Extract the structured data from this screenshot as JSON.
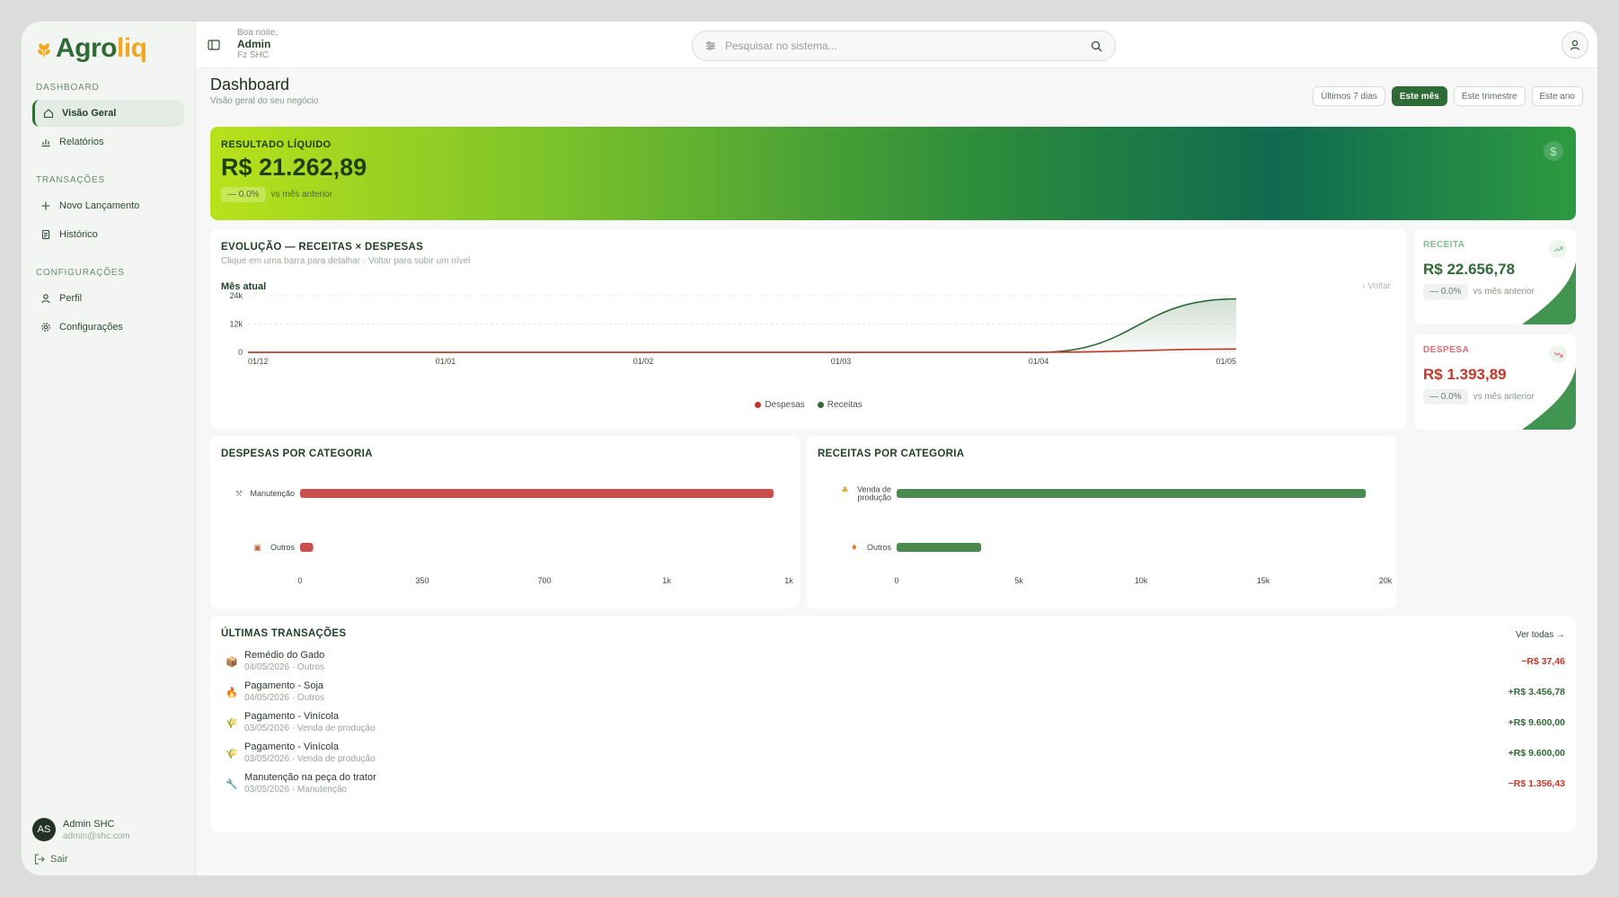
{
  "app": {
    "logo_a": "Agro",
    "logo_b": "liq"
  },
  "sidebar": {
    "sections": [
      {
        "title": "DASHBOARD",
        "items": [
          {
            "label": "Visão Geral",
            "icon": "home-icon",
            "active": true
          },
          {
            "label": "Relatórios",
            "icon": "bar-chart-icon"
          }
        ]
      },
      {
        "title": "TRANSAÇÕES",
        "items": [
          {
            "label": "Novo Lançamento",
            "icon": "plus-icon"
          },
          {
            "label": "Histórico",
            "icon": "document-icon"
          }
        ]
      },
      {
        "title": "CONFIGURAÇÕES",
        "items": [
          {
            "label": "Perfil",
            "icon": "user-icon"
          },
          {
            "label": "Configurações",
            "icon": "gear-icon"
          }
        ]
      }
    ],
    "user": {
      "initials": "AS",
      "name": "Admin SHC",
      "email": "admin@shc.com"
    },
    "logout_label": "Sair"
  },
  "header": {
    "greeting": "Boa noite,",
    "user": "Admin",
    "farm": "Fz SHC",
    "search_placeholder": "Pesquisar no sistema..."
  },
  "page": {
    "title": "Dashboard",
    "subtitle": "Visão geral do seu negócio",
    "periods": [
      "Últimos 7 dias",
      "Este mês",
      "Este trimestre",
      "Este ano"
    ],
    "active_period": "Este mês"
  },
  "hero": {
    "label": "RESULTADO LÍQUIDO",
    "value": "R$ 21.262,89",
    "delta": "— 0.0%",
    "delta_text": "vs mês anterior",
    "icon": "dollar-icon"
  },
  "kpis": [
    {
      "label": "RECEITA",
      "value": "R$ 22.656,78",
      "delta": "— 0.0%",
      "delta_text": "vs mês anterior",
      "color": "#2e6b35",
      "label_color": "#7dbf8a",
      "icon": "trend-up-icon"
    },
    {
      "label": "DESPESA",
      "value": "R$ 1.393,89",
      "delta": "— 0.0%",
      "delta_text": "vs mês anterior",
      "color": "#c0392b",
      "label_color": "#e06a76",
      "icon": "trend-down-icon"
    }
  ],
  "evolution": {
    "title": "EVOLUÇÃO — RECEITAS × DESPESAS",
    "subtitle": "Clique em uma barra para detalhar · Voltar para subir um nível",
    "period_label": "Mês atual",
    "back_label": "‹ Voltar"
  },
  "categories_expense": {
    "title": "DESPESAS POR CATEGORIA"
  },
  "categories_income": {
    "title": "RECEITAS POR CATEGORIA"
  },
  "chart_data": [
    {
      "type": "area",
      "title": "EVOLUÇÃO — RECEITAS × DESPESAS",
      "x": [
        "01/12",
        "01/01",
        "01/02",
        "01/03",
        "01/04",
        "01/05"
      ],
      "ylim": [
        0,
        24000
      ],
      "yticks": [
        "24k",
        "12k",
        "0"
      ],
      "series": [
        {
          "name": "Despesas",
          "color": "#c0392b",
          "values": [
            0,
            0,
            0,
            0,
            0,
            1393.89
          ]
        },
        {
          "name": "Receitas",
          "color": "#2e6b35",
          "values": [
            0,
            0,
            0,
            0,
            0,
            22656.78
          ]
        }
      ],
      "legend": "bottom-center"
    },
    {
      "type": "bar",
      "orientation": "horizontal",
      "title": "DESPESAS POR CATEGORIA",
      "categories": [
        {
          "label": "Manutenção",
          "icon": "wrench-icon"
        },
        {
          "label": "Outros",
          "icon": "box-icon"
        }
      ],
      "values": [
        1356.43,
        37.46
      ],
      "xlim": [
        0,
        1400
      ],
      "xticks": [
        "0",
        "350",
        "700",
        "1k",
        "1k"
      ],
      "color": "#c9504d"
    },
    {
      "type": "bar",
      "orientation": "horizontal",
      "title": "RECEITAS POR CATEGORIA",
      "categories": [
        {
          "label": "Venda de produção",
          "lines": [
            "Venda de",
            "produção"
          ],
          "icon": "wheat-icon"
        },
        {
          "label": "Outros",
          "icon": "fire-icon"
        }
      ],
      "values": [
        19200,
        3456.78
      ],
      "xlim": [
        0,
        20000
      ],
      "xticks": [
        "0",
        "5k",
        "10k",
        "15k",
        "20k"
      ],
      "color": "#4a8a4f"
    }
  ],
  "transactions": {
    "title": "ÚLTIMAS TRANSAÇÕES",
    "see_all": "Ver todas →",
    "items": [
      {
        "title": "Remédio do Gado",
        "meta": "04/05/2026 · Outros",
        "amount": "−R$ 37,46",
        "kind": "neg",
        "icon": "📦"
      },
      {
        "title": "Pagamento - Soja",
        "meta": "04/05/2026 · Outros",
        "amount": "+R$ 3.456,78",
        "kind": "pos",
        "icon": "🔥"
      },
      {
        "title": "Pagamento - Vinícola",
        "meta": "03/05/2026 · Venda de produção",
        "amount": "+R$ 9.600,00",
        "kind": "pos",
        "icon": "🌾"
      },
      {
        "title": "Pagamento - Vinícola",
        "meta": "03/05/2026 · Venda de produção",
        "amount": "+R$ 9.600,00",
        "kind": "pos",
        "icon": "🌾"
      },
      {
        "title": "Manutenção na peça do trator",
        "meta": "03/05/2026 · Manutenção",
        "amount": "−R$ 1.356,43",
        "kind": "neg",
        "icon": "🔧"
      }
    ]
  }
}
